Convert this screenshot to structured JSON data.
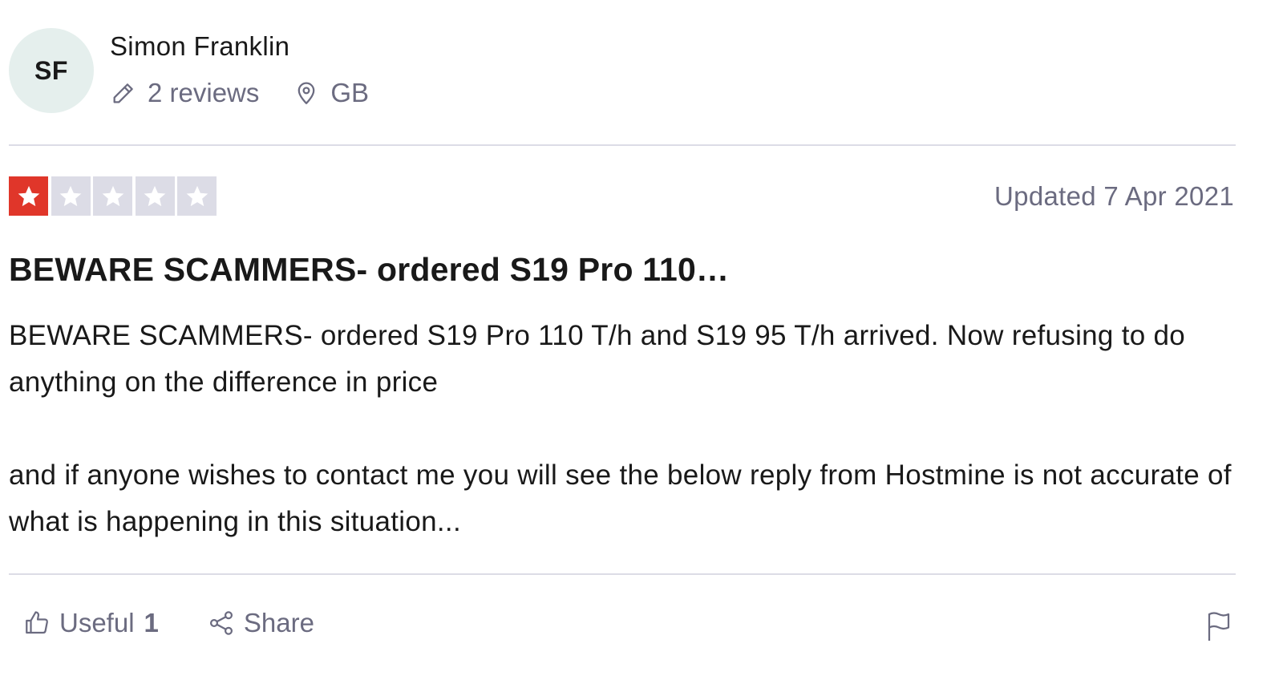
{
  "consumer": {
    "initials": "SF",
    "name": "Simon Franklin",
    "reviews_count": "2 reviews",
    "country": "GB"
  },
  "review": {
    "rating": 1,
    "max_rating": 5,
    "date": "Updated 7 Apr 2021",
    "title": "BEWARE SCAMMERS- ordered S19 Pro 110…",
    "paragraphs": [
      "BEWARE SCAMMERS- ordered S19 Pro 110 T/h and S19 95 T/h arrived. Now refusing to do anything on the difference in price",
      "and if anyone wishes to contact me you will see the below reply from Hostmine is not accurate of what is happening in this situation..."
    ]
  },
  "actions": {
    "useful_label": "Useful",
    "useful_count": "1",
    "share_label": "Share"
  },
  "colors": {
    "star_active": "#e0362a",
    "star_inactive": "#dcdce6",
    "muted_text": "#6b6b80",
    "avatar_bg": "#e5efed"
  },
  "icons": {
    "reviews": "pencil-icon",
    "country": "location-pin-icon",
    "useful": "thumbs-up-icon",
    "share": "share-icon",
    "report": "flag-icon"
  }
}
